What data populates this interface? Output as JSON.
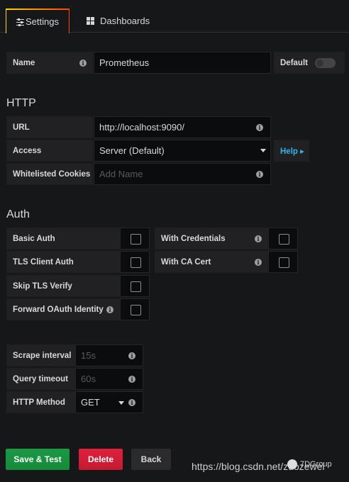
{
  "tabs": {
    "settings": "Settings",
    "dashboards": "Dashboards"
  },
  "general": {
    "name_label": "Name",
    "name_value": "Prometheus",
    "default_label": "Default",
    "default_enabled": false
  },
  "http": {
    "title": "HTTP",
    "url_label": "URL",
    "url_value": "http://localhost:9090/",
    "access_label": "Access",
    "access_value": "Server (Default)",
    "help_label": "Help ▸",
    "cookies_label": "Whitelisted Cookies",
    "cookies_placeholder": "Add Name"
  },
  "auth": {
    "title": "Auth",
    "basic_auth": "Basic Auth",
    "with_credentials": "With Credentials",
    "tls_client_auth": "TLS Client Auth",
    "with_ca_cert": "With CA Cert",
    "skip_tls_verify": "Skip TLS Verify",
    "forward_oauth": "Forward OAuth Identity"
  },
  "misc": {
    "scrape_label": "Scrape interval",
    "scrape_placeholder": "15s",
    "query_label": "Query timeout",
    "query_placeholder": "60s",
    "method_label": "HTTP Method",
    "method_value": "GET"
  },
  "buttons": {
    "save": "Save & Test",
    "delete": "Delete",
    "back": "Back"
  },
  "watermark": {
    "url": "https://blog.csdn.net/zuozewei",
    "brand": "7DGroup"
  },
  "colors": {
    "save": "#1a9a44",
    "delete": "#e0203a",
    "help": "#33b5e5"
  }
}
